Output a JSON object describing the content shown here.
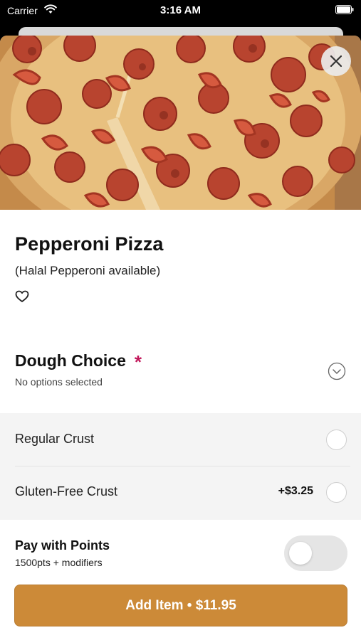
{
  "status_bar": {
    "carrier": "Carrier",
    "time": "3:16 AM"
  },
  "item": {
    "title": "Pepperoni Pizza",
    "subtitle": "(Halal Pepperoni available)",
    "favorite_icon": "heart-outline-icon",
    "close_icon": "close-icon"
  },
  "modifier_group": {
    "title": "Dough Choice",
    "required_mark": "*",
    "status": "No options selected",
    "toggle_icon": "chevron-down-circle-icon",
    "options": [
      {
        "label": "Regular Crust",
        "price": ""
      },
      {
        "label": "Gluten-Free Crust",
        "price": "+$3.25"
      }
    ]
  },
  "points": {
    "title": "Pay with Points",
    "subtitle": "1500pts + modifiers",
    "enabled": false
  },
  "add_button": {
    "label": "Add Item • $11.95"
  },
  "colors": {
    "accent": "#cc8a38",
    "required": "#c2185b",
    "options_background": "#f4f4f4"
  }
}
